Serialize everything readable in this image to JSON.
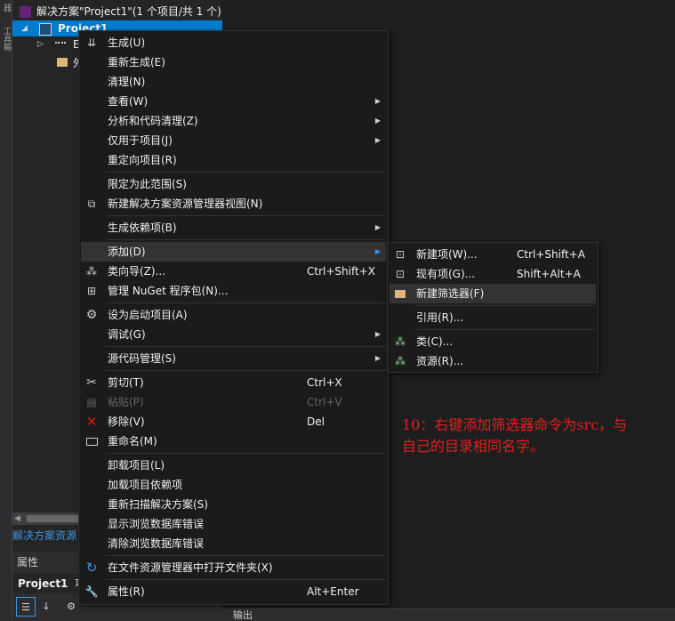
{
  "left_strip": {
    "labels": [
      "器",
      "工具箱"
    ]
  },
  "tree": {
    "solution_label": "解决方案\"Project1\"(1 个项目/共 1 个)",
    "project_label": "Project1",
    "child1_label": "E",
    "child2_label": "外"
  },
  "panel_tab": "解决方案资源",
  "properties": {
    "title": "属性",
    "object": "Project1",
    "object_suffix": "项"
  },
  "output_tab": "输出",
  "context_menu": {
    "items": [
      {
        "label": "生成(U)"
      },
      {
        "label": "重新生成(E)"
      },
      {
        "label": "清理(N)"
      },
      {
        "label": "查看(W)"
      },
      {
        "label": "分析和代码清理(Z)"
      },
      {
        "label": "仅用于项目(J)"
      },
      {
        "label": "重定向项目(R)"
      },
      {
        "label": "限定为此范围(S)"
      },
      {
        "label": "新建解决方案资源管理器视图(N)"
      },
      {
        "label": "生成依赖项(B)"
      },
      {
        "label": "添加(D)"
      },
      {
        "label": "类向导(Z)...",
        "shortcut": "Ctrl+Shift+X"
      },
      {
        "label": "管理 NuGet 程序包(N)..."
      },
      {
        "label": "设为启动项目(A)"
      },
      {
        "label": "调试(G)"
      },
      {
        "label": "源代码管理(S)"
      },
      {
        "label": "剪切(T)",
        "shortcut": "Ctrl+X"
      },
      {
        "label": "粘贴(P)",
        "shortcut": "Ctrl+V"
      },
      {
        "label": "移除(V)",
        "shortcut": "Del"
      },
      {
        "label": "重命名(M)"
      },
      {
        "label": "卸载项目(L)"
      },
      {
        "label": "加载项目依赖项"
      },
      {
        "label": "重新扫描解决方案(S)"
      },
      {
        "label": "显示浏览数据库错误"
      },
      {
        "label": "清除浏览数据库错误"
      },
      {
        "label": "在文件资源管理器中打开文件夹(X)"
      },
      {
        "label": "属性(R)",
        "shortcut": "Alt+Enter"
      }
    ]
  },
  "submenu": {
    "items": [
      {
        "label": "新建项(W)...",
        "shortcut": "Ctrl+Shift+A"
      },
      {
        "label": "现有项(G)...",
        "shortcut": "Shift+Alt+A"
      },
      {
        "label": "新建筛选器(F)"
      },
      {
        "label": "引用(R)..."
      },
      {
        "label": "类(C)..."
      },
      {
        "label": "资源(R)..."
      }
    ]
  },
  "annotation": {
    "line1": "10：右键添加筛选器命令为src，与",
    "line2": "自己的目录相同名字。"
  }
}
